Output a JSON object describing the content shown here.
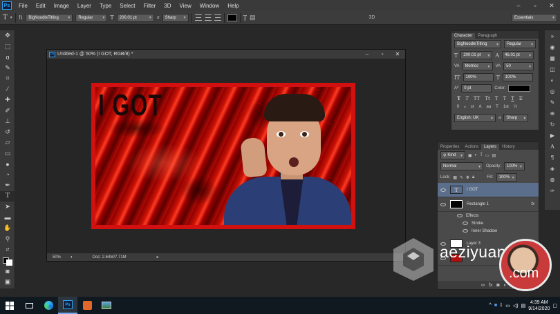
{
  "app": {
    "logo": "Ps",
    "doc_title": "Untitled-1 @ 50% (I GOT, RGB/8) *"
  },
  "menu": [
    "File",
    "Edit",
    "Image",
    "Layer",
    "Type",
    "Select",
    "Filter",
    "3D",
    "View",
    "Window",
    "Help"
  ],
  "options": {
    "tool_glyph": "T",
    "font_family": "BigNoodleTitling",
    "font_style": "Regular",
    "font_size": "200.01 pt",
    "aa_prefix": "a",
    "aa_label": "Sharp",
    "three_d": "3D",
    "workspace": "Essentials",
    "text_color": "#000000"
  },
  "canvas": {
    "headline": "I GOT",
    "border_color": "#d21010"
  },
  "status": {
    "zoom": "50%",
    "doc": "Doc: 2.64M/7.71M"
  },
  "character_panel": {
    "tabs": [
      "Character",
      "Paragraph"
    ],
    "font_family": "BigNoodleTitling",
    "font_style": "Regular",
    "size": "200.01 pt",
    "leading": "46.01 pt",
    "kerning": "Metrics",
    "tracking": "50",
    "vscale": "100%",
    "hscale": "100%",
    "baseline": "0 pt",
    "color_label": "Color:",
    "style_buttons": [
      "T",
      "T",
      "TT",
      "Tt",
      "T",
      "T",
      "T",
      "T"
    ],
    "ot_buttons": [
      "fi",
      "ℴ",
      "st",
      "A",
      "aa",
      "T",
      "1st",
      "½"
    ],
    "language": "English: UK",
    "aa": "Sharp"
  },
  "layers_panel": {
    "tabs": [
      "Properties",
      "Actions",
      "Layers",
      "History"
    ],
    "active_tab": "Layers",
    "filter_label": "Kind",
    "blend_mode": "Normal",
    "opacity_label": "Opacity:",
    "opacity": "100%",
    "lock_label": "Lock:",
    "fill_label": "Fill:",
    "fill": "100%",
    "layers": [
      {
        "name": "I GOT",
        "kind": "text",
        "selected": true
      },
      {
        "name": "Rectangle 1",
        "kind": "shape",
        "fx": "fx"
      }
    ],
    "effects_label": "Effects",
    "effects": [
      "Stroke",
      "Inner Shadow"
    ],
    "layer3": "Layer 3"
  },
  "watermark": {
    "line1": "aeziyuan",
    "line2": ".com"
  },
  "taskbar": {
    "time": "4:39 AM",
    "date": "9/14/2020"
  }
}
